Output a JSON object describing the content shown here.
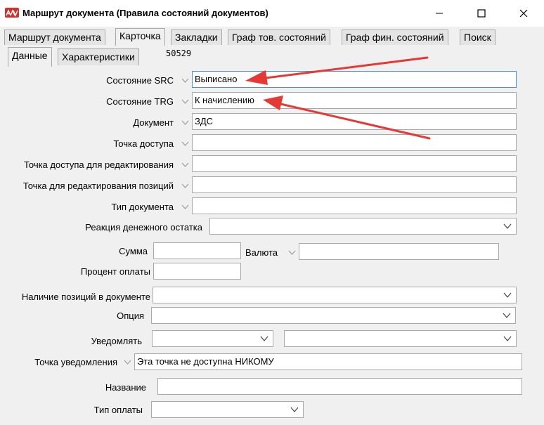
{
  "window": {
    "title": "Маршрут документа (Правила состояний документов)"
  },
  "tabs": [
    {
      "label": "Маршрут документа"
    },
    {
      "label": "Карточка"
    },
    {
      "label": "Закладки"
    },
    {
      "label": "Граф тов. состояний"
    },
    {
      "label": "Граф фин. состояний"
    },
    {
      "label": "Поиск"
    }
  ],
  "subtabs": [
    {
      "label": "Данные"
    },
    {
      "label": "Характеристики"
    }
  ],
  "doc_id": "50529",
  "form": {
    "state_src": {
      "label": "Состояние SRC",
      "value": "Выписано"
    },
    "state_trg": {
      "label": "Состояние TRG",
      "value": "К начислению"
    },
    "document": {
      "label": "Документ",
      "value": "ЗДС"
    },
    "access_point": {
      "label": "Точка доступа",
      "value": ""
    },
    "edit_access_point": {
      "label": "Точка доступа для редактирования",
      "value": ""
    },
    "edit_positions_point": {
      "label": "Точка для редактирования позиций",
      "value": ""
    },
    "doc_type": {
      "label": "Тип документа",
      "value": ""
    },
    "money_reaction": {
      "label": "Реакция денежного остатка",
      "value": ""
    },
    "sum": {
      "label": "Сумма",
      "value": ""
    },
    "currency": {
      "label": "Валюта",
      "value": ""
    },
    "pay_percent": {
      "label": "Процент оплаты",
      "value": ""
    },
    "positions_presence": {
      "label": "Наличие позиций в документе",
      "value": ""
    },
    "option": {
      "label": "Опция",
      "value": ""
    },
    "notify": {
      "label": "Уведомлять",
      "value1": "",
      "value2": ""
    },
    "notify_point": {
      "label": "Точка уведомления",
      "value": "Эта точка не доступна НИКОМУ"
    },
    "name": {
      "label": "Название",
      "value": ""
    },
    "pay_type": {
      "label": "Тип оплаты",
      "value": ""
    }
  },
  "colors": {
    "accent": "#4a90d9",
    "annotation_arrow": "#e53935"
  }
}
